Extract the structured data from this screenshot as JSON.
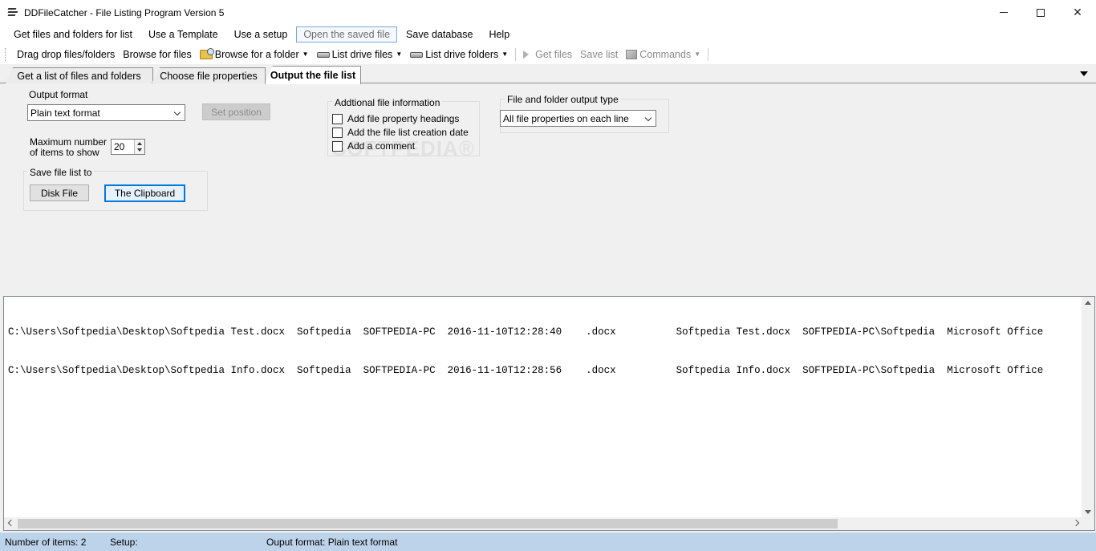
{
  "window": {
    "title": "DDFileCatcher - File Listing Program Version 5",
    "minimize": "—",
    "maximize": "□",
    "close": "✕"
  },
  "menu": [
    {
      "label": "Get files and folders for list"
    },
    {
      "label": "Use a Template"
    },
    {
      "label": "Use a setup"
    },
    {
      "label": "Open the saved file"
    },
    {
      "label": "Save database"
    },
    {
      "label": "Help"
    }
  ],
  "toolbar": {
    "drag_drop": "Drag drop files/folders",
    "browse_files": "Browse for files",
    "browse_folder": "Browse for a folder",
    "list_drive_files": "List drive files",
    "list_drive_folders": "List drive folders",
    "get_files": "Get files",
    "save_list": "Save list",
    "commands": "Commands",
    "caret": "▼"
  },
  "tabs": [
    {
      "label": "Get a list of files and folders"
    },
    {
      "label": "Choose file properties"
    },
    {
      "label": "Output the file list"
    }
  ],
  "output_panel": {
    "output_format_label": "Output format",
    "output_format_value": "Plain text format",
    "set_position_label": "Set position",
    "max_items_label_1": "Maximum number",
    "max_items_label_2": "of items to show",
    "max_items_value": "20",
    "save_to_title": "Save file list to",
    "disk_file_label": "Disk File",
    "clipboard_label": "The Clipboard",
    "additional_title": "Addtional file information",
    "check_headings": "Add file property headings",
    "check_creation_date": "Add the file list creation date",
    "check_comment": "Add a comment",
    "output_type_title": "File and folder output type",
    "output_type_value": "All file properties on each line",
    "watermark": "SOFTPEDIA®"
  },
  "file_list": [
    "C:\\Users\\Softpedia\\Desktop\\Softpedia Test.docx  Softpedia  SOFTPEDIA-PC  2016-11-10T12:28:40    .docx          Softpedia Test.docx  SOFTPEDIA-PC\\Softpedia  Microsoft Office",
    "C:\\Users\\Softpedia\\Desktop\\Softpedia Info.docx  Softpedia  SOFTPEDIA-PC  2016-11-10T12:28:56    .docx          Softpedia Info.docx  SOFTPEDIA-PC\\Softpedia  Microsoft Office"
  ],
  "status": {
    "items": "Number of items: 2",
    "setup": "Setup:",
    "format": "Ouput format: Plain text format"
  },
  "colors": {
    "status_bar": "#bdd3ea",
    "focus_accent": "#0078d7"
  }
}
